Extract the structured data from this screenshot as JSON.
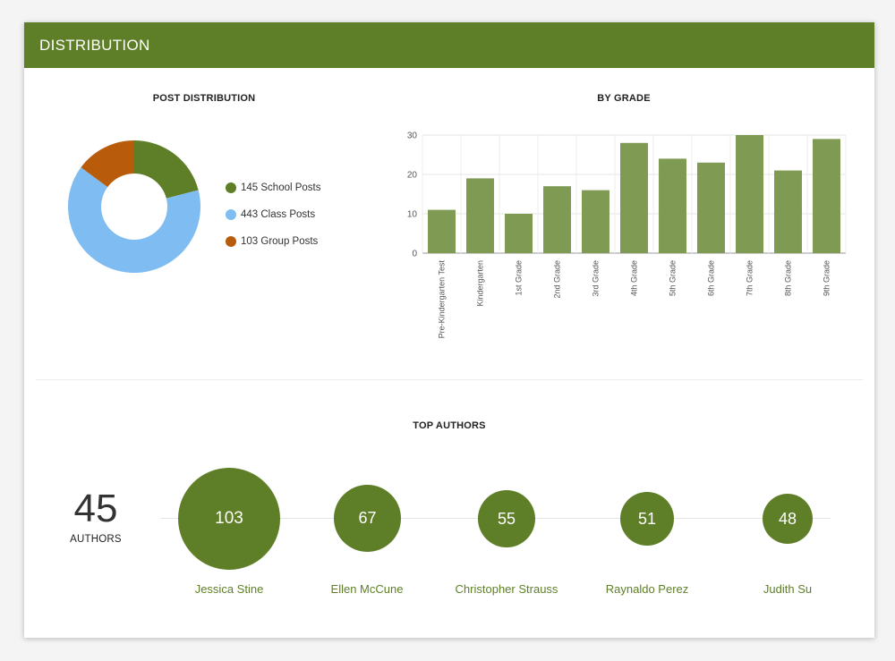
{
  "header": {
    "title": "DISTRIBUTION"
  },
  "post_distribution": {
    "title": "POST DISTRIBUTION",
    "legend": [
      {
        "label": "145 School Posts",
        "value": 145,
        "color": "#5e7f27"
      },
      {
        "label": "443 Class Posts",
        "value": 443,
        "color": "#7fbcf2"
      },
      {
        "label": "103 Group Posts",
        "value": 103,
        "color": "#b85c0b"
      }
    ]
  },
  "top_authors": {
    "title": "TOP AUTHORS",
    "total_count": "45",
    "total_label": "AUTHORS",
    "authors": [
      {
        "name": "Jessica Stine",
        "posts": "103"
      },
      {
        "name": "Ellen McCune",
        "posts": "67"
      },
      {
        "name": "Christopher Strauss",
        "posts": "55"
      },
      {
        "name": "Raynaldo Perez",
        "posts": "51"
      },
      {
        "name": "Judith Su",
        "posts": "48"
      }
    ]
  },
  "chart_data": [
    {
      "type": "pie",
      "title": "POST DISTRIBUTION",
      "donut": true,
      "categories": [
        "School Posts",
        "Class Posts",
        "Group Posts"
      ],
      "values": [
        145,
        443,
        103
      ],
      "colors": [
        "#5e7f27",
        "#7fbcf2",
        "#b85c0b"
      ],
      "legend": "right"
    },
    {
      "type": "bar",
      "title": "BY GRADE",
      "categories": [
        "Pre-Kindergarten Test",
        "Kindergarten",
        "1st Grade",
        "2nd Grade",
        "3rd Grade",
        "4th Grade",
        "5th Grade",
        "6th Grade",
        "7th Grade",
        "8th Grade",
        "9th Grade"
      ],
      "values": [
        11,
        19,
        10,
        17,
        16,
        28,
        24,
        23,
        30,
        21,
        29
      ],
      "xlabel": "",
      "ylabel": "",
      "ylim": [
        0,
        30
      ],
      "yticks": [
        "0",
        "10",
        "20",
        "30"
      ],
      "grid": true,
      "bar_color": "#7f9a52"
    }
  ]
}
